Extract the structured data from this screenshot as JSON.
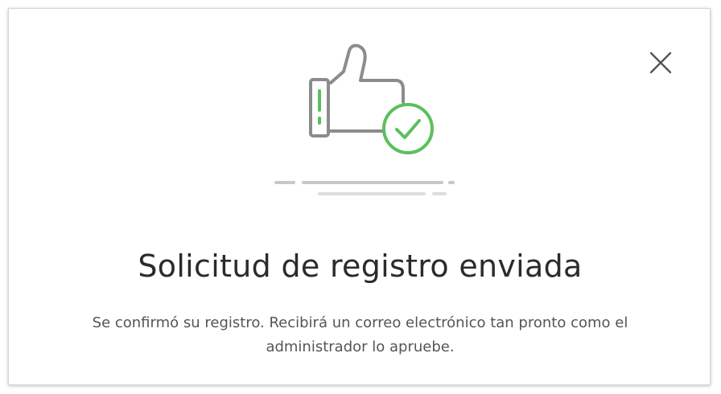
{
  "dialog": {
    "title": "Solicitud de registro enviada",
    "message": "Se confirmó su registro. Recibirá un correo electrónico tan pronto como el administrador lo apruebe.",
    "close_icon": "close-icon",
    "illustration_icons": [
      "thumbs-up-icon",
      "check-circle-icon"
    ]
  },
  "colors": {
    "accent_green": "#5cbf5f",
    "icon_gray": "#8c8c8c",
    "line_gray": "#c8c8c8"
  }
}
